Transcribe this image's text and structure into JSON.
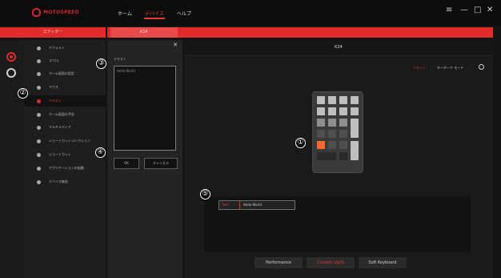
{
  "titlebar": {
    "logo_text": "MOTOSPEED",
    "nav": [
      "ホーム",
      "デバイス",
      "ヘルプ"
    ],
    "active_nav": "デバイス",
    "controls": [
      "≡",
      "—",
      "□",
      "✕"
    ]
  },
  "redbar": {
    "section_label": "エディター",
    "tab_label": "K24"
  },
  "menu": {
    "items": [
      "デフォルト",
      "マクロ",
      "ホーム画面の設定",
      "マウス",
      "テキスト",
      "ホーム画面の予告",
      "マルチメディア",
      "ショートカットコレクション",
      "ショートカット",
      "アプリケーションの起動",
      "デバイス無効"
    ],
    "active_index": 4
  },
  "panel": {
    "close_glyph": "✕",
    "text_label": "テキスト",
    "text_value": "Hello World",
    "ok_label": "OK",
    "cancel_label": "キャンセル"
  },
  "main": {
    "title": "K24",
    "link_red": "リセット",
    "link_white": "キーボード モード",
    "icon_gear": "gear-icon"
  },
  "bottom": {
    "field_label": "Text",
    "field_value": "Hello World"
  },
  "tabs": [
    "Performance",
    "Custom Light",
    "Soft Keyboard"
  ],
  "active_tab": "Custom Light",
  "callouts": [
    "①",
    "②",
    "③",
    "④",
    "⑤"
  ],
  "colors": {
    "accent": "#e02b2b",
    "selected_key": "#f26b2b",
    "background": "#141414"
  }
}
